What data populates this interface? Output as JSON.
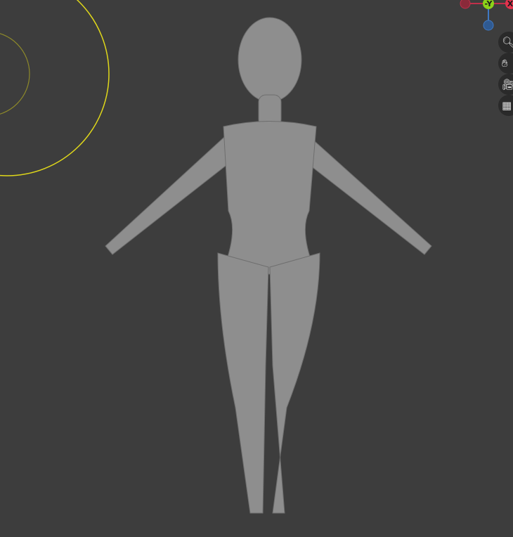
{
  "gizmo": {
    "axes": [
      {
        "label": "-Y",
        "color": "#8cd219"
      },
      {
        "label": "X",
        "color": "#e2334d"
      },
      {
        "label": "",
        "color": "#3f79c4"
      },
      {
        "label": "",
        "color": "#8a2a3a"
      }
    ]
  },
  "nav_buttons": [
    {
      "name": "zoom",
      "icon": "magnifier-plus-icon"
    },
    {
      "name": "pan",
      "icon": "hand-icon"
    },
    {
      "name": "camera",
      "icon": "camera-icon"
    },
    {
      "name": "ortho-toggle",
      "icon": "grid-icon"
    }
  ],
  "colors": {
    "background": "#3d3d3d",
    "light_gizmo": "#e0d81a",
    "model": "#8e8e8e"
  }
}
